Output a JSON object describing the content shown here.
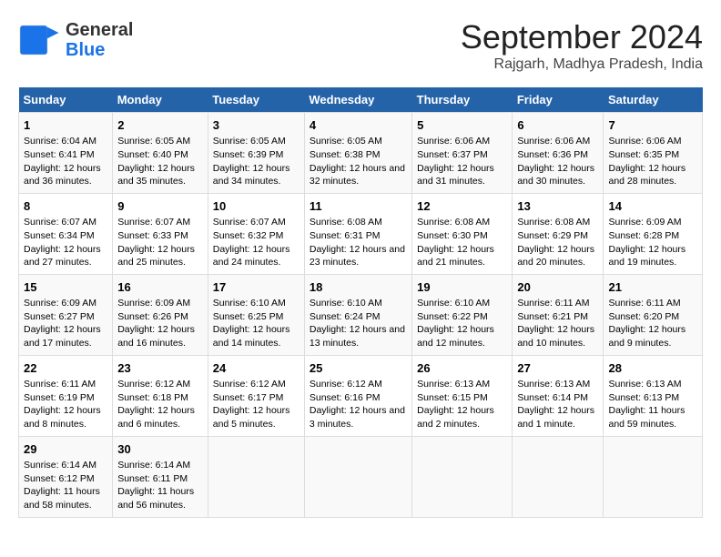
{
  "header": {
    "logo_general": "General",
    "logo_blue": "Blue",
    "title": "September 2024",
    "subtitle": "Rajgarh, Madhya Pradesh, India"
  },
  "weekdays": [
    "Sunday",
    "Monday",
    "Tuesday",
    "Wednesday",
    "Thursday",
    "Friday",
    "Saturday"
  ],
  "weeks": [
    [
      {
        "day": "1",
        "sunrise": "6:04 AM",
        "sunset": "6:41 PM",
        "daylight": "12 hours and 36 minutes."
      },
      {
        "day": "2",
        "sunrise": "6:05 AM",
        "sunset": "6:40 PM",
        "daylight": "12 hours and 35 minutes."
      },
      {
        "day": "3",
        "sunrise": "6:05 AM",
        "sunset": "6:39 PM",
        "daylight": "12 hours and 34 minutes."
      },
      {
        "day": "4",
        "sunrise": "6:05 AM",
        "sunset": "6:38 PM",
        "daylight": "12 hours and 32 minutes."
      },
      {
        "day": "5",
        "sunrise": "6:06 AM",
        "sunset": "6:37 PM",
        "daylight": "12 hours and 31 minutes."
      },
      {
        "day": "6",
        "sunrise": "6:06 AM",
        "sunset": "6:36 PM",
        "daylight": "12 hours and 30 minutes."
      },
      {
        "day": "7",
        "sunrise": "6:06 AM",
        "sunset": "6:35 PM",
        "daylight": "12 hours and 28 minutes."
      }
    ],
    [
      {
        "day": "8",
        "sunrise": "6:07 AM",
        "sunset": "6:34 PM",
        "daylight": "12 hours and 27 minutes."
      },
      {
        "day": "9",
        "sunrise": "6:07 AM",
        "sunset": "6:33 PM",
        "daylight": "12 hours and 25 minutes."
      },
      {
        "day": "10",
        "sunrise": "6:07 AM",
        "sunset": "6:32 PM",
        "daylight": "12 hours and 24 minutes."
      },
      {
        "day": "11",
        "sunrise": "6:08 AM",
        "sunset": "6:31 PM",
        "daylight": "12 hours and 23 minutes."
      },
      {
        "day": "12",
        "sunrise": "6:08 AM",
        "sunset": "6:30 PM",
        "daylight": "12 hours and 21 minutes."
      },
      {
        "day": "13",
        "sunrise": "6:08 AM",
        "sunset": "6:29 PM",
        "daylight": "12 hours and 20 minutes."
      },
      {
        "day": "14",
        "sunrise": "6:09 AM",
        "sunset": "6:28 PM",
        "daylight": "12 hours and 19 minutes."
      }
    ],
    [
      {
        "day": "15",
        "sunrise": "6:09 AM",
        "sunset": "6:27 PM",
        "daylight": "12 hours and 17 minutes."
      },
      {
        "day": "16",
        "sunrise": "6:09 AM",
        "sunset": "6:26 PM",
        "daylight": "12 hours and 16 minutes."
      },
      {
        "day": "17",
        "sunrise": "6:10 AM",
        "sunset": "6:25 PM",
        "daylight": "12 hours and 14 minutes."
      },
      {
        "day": "18",
        "sunrise": "6:10 AM",
        "sunset": "6:24 PM",
        "daylight": "12 hours and 13 minutes."
      },
      {
        "day": "19",
        "sunrise": "6:10 AM",
        "sunset": "6:22 PM",
        "daylight": "12 hours and 12 minutes."
      },
      {
        "day": "20",
        "sunrise": "6:11 AM",
        "sunset": "6:21 PM",
        "daylight": "12 hours and 10 minutes."
      },
      {
        "day": "21",
        "sunrise": "6:11 AM",
        "sunset": "6:20 PM",
        "daylight": "12 hours and 9 minutes."
      }
    ],
    [
      {
        "day": "22",
        "sunrise": "6:11 AM",
        "sunset": "6:19 PM",
        "daylight": "12 hours and 8 minutes."
      },
      {
        "day": "23",
        "sunrise": "6:12 AM",
        "sunset": "6:18 PM",
        "daylight": "12 hours and 6 minutes."
      },
      {
        "day": "24",
        "sunrise": "6:12 AM",
        "sunset": "6:17 PM",
        "daylight": "12 hours and 5 minutes."
      },
      {
        "day": "25",
        "sunrise": "6:12 AM",
        "sunset": "6:16 PM",
        "daylight": "12 hours and 3 minutes."
      },
      {
        "day": "26",
        "sunrise": "6:13 AM",
        "sunset": "6:15 PM",
        "daylight": "12 hours and 2 minutes."
      },
      {
        "day": "27",
        "sunrise": "6:13 AM",
        "sunset": "6:14 PM",
        "daylight": "12 hours and 1 minute."
      },
      {
        "day": "28",
        "sunrise": "6:13 AM",
        "sunset": "6:13 PM",
        "daylight": "11 hours and 59 minutes."
      }
    ],
    [
      {
        "day": "29",
        "sunrise": "6:14 AM",
        "sunset": "6:12 PM",
        "daylight": "11 hours and 58 minutes."
      },
      {
        "day": "30",
        "sunrise": "6:14 AM",
        "sunset": "6:11 PM",
        "daylight": "11 hours and 56 minutes."
      },
      null,
      null,
      null,
      null,
      null
    ]
  ],
  "labels": {
    "sunrise": "Sunrise:",
    "sunset": "Sunset:",
    "daylight": "Daylight:"
  }
}
